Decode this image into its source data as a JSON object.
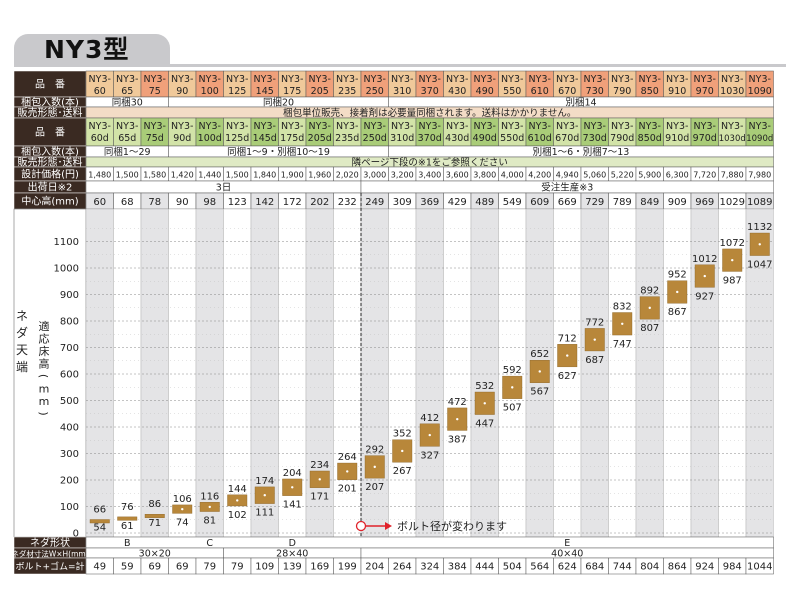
{
  "title": "NY3型",
  "header": {
    "hinban_label": "品　番",
    "konpo_label": "梱包入数(本)",
    "hanbai_label": "販売形態･送料",
    "hinban2_label": "品　番",
    "konpo2_label": "梱包入数(本)",
    "hanbai2_label": "販売形態･送料",
    "price_label": "設計価格(円)",
    "lead_label": "出荷日※2",
    "center_label": "中心高(mm)"
  },
  "models": [
    {
      "p": "NY3-",
      "n": "60",
      "c": "#f0c99a"
    },
    {
      "p": "NY3-",
      "n": "65",
      "c": "#f0c99a"
    },
    {
      "p": "NY3-",
      "n": "75",
      "c": "#f0a07a"
    },
    {
      "p": "NY3-",
      "n": "90",
      "c": "#f0c99a"
    },
    {
      "p": "NY3-",
      "n": "100",
      "c": "#f0a07a"
    },
    {
      "p": "NY3-",
      "n": "125",
      "c": "#f0c99a"
    },
    {
      "p": "NY3-",
      "n": "145",
      "c": "#f0a07a"
    },
    {
      "p": "NY3-",
      "n": "175",
      "c": "#f0c99a"
    },
    {
      "p": "NY3-",
      "n": "205",
      "c": "#f0a07a"
    },
    {
      "p": "NY3-",
      "n": "235",
      "c": "#f0c99a"
    },
    {
      "p": "NY3-",
      "n": "250",
      "c": "#f0a07a"
    },
    {
      "p": "NY3-",
      "n": "310",
      "c": "#f0c99a"
    },
    {
      "p": "NY3-",
      "n": "370",
      "c": "#f0a07a"
    },
    {
      "p": "NY3-",
      "n": "430",
      "c": "#f0c99a"
    },
    {
      "p": "NY3-",
      "n": "490",
      "c": "#f0a07a"
    },
    {
      "p": "NY3-",
      "n": "550",
      "c": "#f0c99a"
    },
    {
      "p": "NY3-",
      "n": "610",
      "c": "#f0a07a"
    },
    {
      "p": "NY3-",
      "n": "670",
      "c": "#f0c99a"
    },
    {
      "p": "NY3-",
      "n": "730",
      "c": "#f0a07a"
    },
    {
      "p": "NY3-",
      "n": "790",
      "c": "#f0c99a"
    },
    {
      "p": "NY3-",
      "n": "850",
      "c": "#f0a07a"
    },
    {
      "p": "NY3-",
      "n": "910",
      "c": "#f0c99a"
    },
    {
      "p": "NY3-",
      "n": "970",
      "c": "#f0a07a"
    },
    {
      "p": "NY3-",
      "n": "1030",
      "c": "#f0c99a"
    },
    {
      "p": "NY3-",
      "n": "1090",
      "c": "#f0a07a"
    }
  ],
  "models_d": [
    {
      "p": "NY3-",
      "n": "60d",
      "c": "#d2e3a8"
    },
    {
      "p": "NY3-",
      "n": "65d",
      "c": "#d2e3a8"
    },
    {
      "p": "NY3-",
      "n": "75d",
      "c": "#a9cc78"
    },
    {
      "p": "NY3-",
      "n": "90d",
      "c": "#d2e3a8"
    },
    {
      "p": "NY3-",
      "n": "100d",
      "c": "#a9cc78"
    },
    {
      "p": "NY3-",
      "n": "125d",
      "c": "#d2e3a8"
    },
    {
      "p": "NY3-",
      "n": "145d",
      "c": "#a9cc78"
    },
    {
      "p": "NY3-",
      "n": "175d",
      "c": "#d2e3a8"
    },
    {
      "p": "NY3-",
      "n": "205d",
      "c": "#a9cc78"
    },
    {
      "p": "NY3-",
      "n": "235d",
      "c": "#d2e3a8"
    },
    {
      "p": "NY3-",
      "n": "250d",
      "c": "#a9cc78"
    },
    {
      "p": "NY3-",
      "n": "310d",
      "c": "#d2e3a8"
    },
    {
      "p": "NY3-",
      "n": "370d",
      "c": "#a9cc78"
    },
    {
      "p": "NY3-",
      "n": "430d",
      "c": "#d2e3a8"
    },
    {
      "p": "NY3-",
      "n": "490d",
      "c": "#a9cc78"
    },
    {
      "p": "NY3-",
      "n": "550d",
      "c": "#d2e3a8"
    },
    {
      "p": "NY3-",
      "n": "610d",
      "c": "#a9cc78"
    },
    {
      "p": "NY3-",
      "n": "670d",
      "c": "#d2e3a8"
    },
    {
      "p": "NY3-",
      "n": "730d",
      "c": "#a9cc78"
    },
    {
      "p": "NY3-",
      "n": "790d",
      "c": "#d2e3a8"
    },
    {
      "p": "NY3-",
      "n": "850d",
      "c": "#a9cc78"
    },
    {
      "p": "NY3-",
      "n": "910d",
      "c": "#d2e3a8"
    },
    {
      "p": "NY3-",
      "n": "970d",
      "c": "#a9cc78"
    },
    {
      "p": "NY3-",
      "n": "1030d",
      "c": "#d2e3a8"
    },
    {
      "p": "NY3-",
      "n": "1090d",
      "c": "#a9cc78"
    }
  ],
  "konpo_groups": [
    {
      "from": 0,
      "to": 2,
      "text": "同梱30"
    },
    {
      "from": 3,
      "to": 10,
      "text": "同梱20"
    },
    {
      "from": 11,
      "to": 24,
      "text": "別梱14"
    }
  ],
  "hanbai_text": "梱包単位販売、接着剤は必要量同梱されます。送料はかかりません。",
  "konpo2_groups": [
    {
      "from": 0,
      "to": 2,
      "text": "同梱1～29"
    },
    {
      "from": 3,
      "to": 10,
      "text": "同梱1～9・別梱10～19"
    },
    {
      "from": 11,
      "to": 24,
      "text": "別梱1～6・別梱7～13"
    }
  ],
  "hanbai2_text": "隣ページ下段の※1をご参照ください",
  "prices": [
    "1,480",
    "1,500",
    "1,580",
    "1,420",
    "1,440",
    "1,500",
    "1,840",
    "1,900",
    "1,960",
    "2,020",
    "3,000",
    "3,200",
    "3,400",
    "3,600",
    "3,800",
    "4,000",
    "4,200",
    "4,940",
    "5,060",
    "5,220",
    "5,900",
    "6,300",
    "7,720",
    "7,880",
    "7,980"
  ],
  "lead_groups": [
    {
      "from": 0,
      "to": 9,
      "text": "3日"
    },
    {
      "from": 10,
      "to": 24,
      "text": "受注生産※3"
    }
  ],
  "center_heights": [
    "60",
    "68",
    "78",
    "90",
    "98",
    "123",
    "142",
    "172",
    "202",
    "232",
    "249",
    "309",
    "369",
    "429",
    "489",
    "549",
    "609",
    "669",
    "729",
    "789",
    "849",
    "909",
    "969",
    "1029",
    "1089"
  ],
  "side_label_outer": "ネダ天端",
  "side_label_inner": "適応床高(mm)",
  "chart_data": {
    "type": "bar",
    "categories": [
      "60",
      "65",
      "75",
      "90",
      "100",
      "125",
      "145",
      "175",
      "205",
      "235",
      "250",
      "310",
      "370",
      "430",
      "490",
      "550",
      "610",
      "670",
      "730",
      "790",
      "850",
      "910",
      "970",
      "1030",
      "1090"
    ],
    "series": [
      {
        "values_min": [
          54,
          61,
          71,
          74,
          81,
          102,
          111,
          141,
          171,
          201,
          207,
          267,
          327,
          387,
          447,
          507,
          567,
          627,
          687,
          747,
          807,
          867,
          927,
          987,
          1047
        ],
        "values_max": [
          66,
          76,
          86,
          106,
          116,
          144,
          174,
          204,
          234,
          264,
          292,
          352,
          412,
          472,
          532,
          592,
          652,
          712,
          772,
          832,
          892,
          952,
          1012,
          1072,
          1132
        ]
      }
    ],
    "ylabel": "適応床高(mm)",
    "yticks": [
      "0",
      "100",
      "200",
      "300",
      "400",
      "500",
      "600",
      "700",
      "800",
      "900",
      "1000",
      "1100"
    ],
    "ylim": [
      0,
      1200
    ],
    "annotation": "ボルト径が変わります",
    "grid": true
  },
  "footer": {
    "neda_label": "ネダ形状",
    "neda_groups": [
      {
        "from": 1,
        "to": 1,
        "text": "B"
      },
      {
        "from": 4,
        "to": 4,
        "text": "C"
      },
      {
        "from": 7,
        "to": 7,
        "text": "D"
      },
      {
        "from": 17,
        "to": 17,
        "text": "E"
      }
    ],
    "dim_label": "ネダ材寸法W×H(mm)",
    "dim_groups": [
      {
        "from": 0,
        "to": 4,
        "text": "30×20"
      },
      {
        "from": 5,
        "to": 9,
        "text": "28×40"
      },
      {
        "from": 10,
        "to": 24,
        "text": "40×40"
      }
    ],
    "bolt_label": "ボルト+ゴム=計",
    "bolt_values": [
      "49",
      "59",
      "69",
      "69",
      "79",
      "79",
      "109",
      "139",
      "169",
      "199",
      "204",
      "264",
      "324",
      "384",
      "444",
      "504",
      "564",
      "624",
      "684",
      "744",
      "804",
      "864",
      "924",
      "984",
      "1044"
    ]
  },
  "colors": {
    "header_dark": "#3a2a22",
    "bar": "#b8873a",
    "bar_edge": "#8a6326",
    "zebra": "#e4e4e6",
    "annotation": "#e0222a"
  }
}
